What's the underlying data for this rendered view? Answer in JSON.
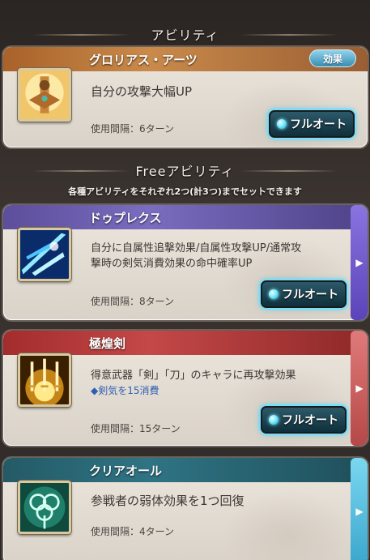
{
  "ability_section": {
    "header": "アビリティ",
    "card": {
      "title": "グロリアス・アーツ",
      "badge": "効果",
      "description": "自分の攻撃大幅UP",
      "cooldown": "使用間隔：6ターン",
      "auto_button": "フルオート",
      "icon": "ornate-statue-icon"
    }
  },
  "free_section": {
    "header": "Freeアビリティ",
    "subtitle": "各種アビリティをそれぞれ2つ(計3つ)までセットできます",
    "cards": [
      {
        "title": "ドゥプレクス",
        "description_line1": "自分に自属性追撃効果/自属性攻撃UP/通常攻",
        "description_line2": "撃時の剣気消費効果の命中確率UP",
        "cooldown": "使用間隔：8ターン",
        "auto_button": "フルオート",
        "icon": "blue-slash-icon",
        "color": "#6e5ca8"
      },
      {
        "title": "極煌剣",
        "description_line1": "得意武器「剣」「刀」のキャラに再攻撃効果",
        "sub_note": "◆剣気を15消費",
        "cooldown": "使用間隔：15ターン",
        "auto_button": "フルオート",
        "icon": "golden-swords-icon",
        "color": "#b23a3a"
      },
      {
        "title": "クリアオール",
        "description_line1": "参戦者の弱体効果を1つ回復",
        "cooldown": "使用間隔：4ターン",
        "icon": "clover-heal-icon",
        "color": "#2f6b78"
      }
    ]
  }
}
